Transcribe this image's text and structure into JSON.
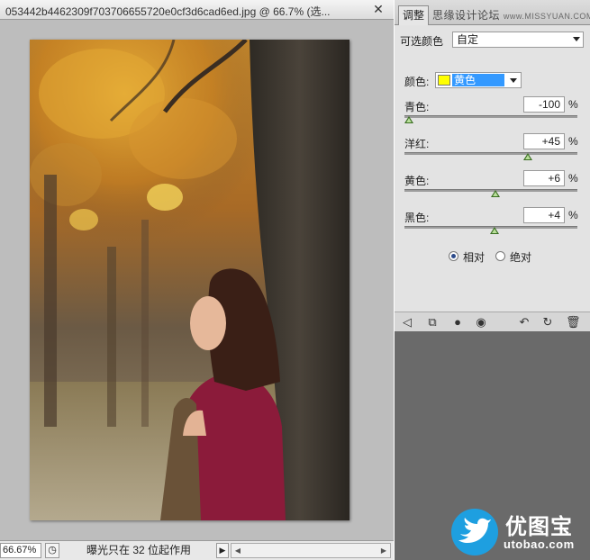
{
  "document": {
    "title": "053442b4462309f703706655720e0cf3d6cad6ed.jpg @ 66.7% (选...",
    "close_glyph": "✕"
  },
  "statusbar": {
    "zoom": "66.67%",
    "message": "曝光只在 32 位起作用",
    "arrow_glyph": "▶"
  },
  "panel": {
    "tab": "调整",
    "watermark_cn": "思缘设计论坛",
    "watermark_en": "www.MISSYUAN.COM",
    "adjustment_name": "可选颜色",
    "preset_value": "自定",
    "colors_label": "颜色:",
    "colors_value": "黄色",
    "colors_swatch": "#ffff00",
    "sliders": [
      {
        "label": "青色:",
        "value": "-100",
        "percent": -100
      },
      {
        "label": "洋红:",
        "value": "+45",
        "percent": 45
      },
      {
        "label": "黄色:",
        "value": "+6",
        "percent": 6
      },
      {
        "label": "黑色:",
        "value": "+4",
        "percent": 4
      }
    ],
    "percent_sign": "%",
    "method_relative": "相对",
    "method_absolute": "绝对",
    "method_selected": "relative"
  },
  "branding": {
    "logo_cn": "优图宝",
    "logo_en": "utobao.com",
    "brand_color": "#1e9fe0"
  }
}
